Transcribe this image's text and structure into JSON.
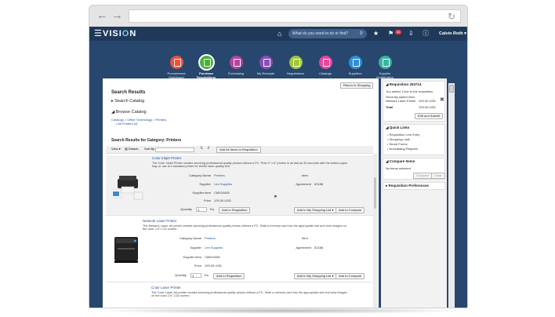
{
  "header": {
    "logo_prefix": "VISI",
    "logo_o": "O",
    "logo_suffix": "N",
    "search_placeholder": "What do you need to do or find?",
    "notifications_count": "11",
    "user_name": "Calvin Roth"
  },
  "nav": {
    "items": [
      {
        "label": "Procurement Dashboard",
        "color": "#e8533f"
      },
      {
        "label": "Purchase Requisitions",
        "color": "#4caf3d"
      },
      {
        "label": "Purchasing",
        "color": "#b4469e"
      },
      {
        "label": "My Receipts",
        "color": "#8b4fb5"
      },
      {
        "label": "Negotiations",
        "color": "#9fc73b"
      },
      {
        "label": "Catalogs",
        "color": "#e7469c"
      },
      {
        "label": "Suppliers",
        "color": "#2f8fd8"
      },
      {
        "label": "Supplier Qualification",
        "color": "#39b3a0"
      }
    ],
    "active_index": 1
  },
  "main": {
    "return_button": "Return to Shopping",
    "search_results_title": "Search Results",
    "search_catalog": "Search Catalog",
    "browse_catalog": "Browse Catalog",
    "breadcrumb": "Catalogs > Office Technology > Printers",
    "all_printers": "All Printers (4)",
    "results_heading": "Search Results for Category: Printers",
    "toolbar": {
      "view": "View",
      "detach": "Detach",
      "sort_by": "Sort By",
      "add_all": "Add All Items to Requisition"
    }
  },
  "products": [
    {
      "name": "Color Inkjet Printer",
      "description_1": "The Color Inkjet Printer creates stunning professional quality photos without a PC. Print 4\" x 6\" photos in as fast as 30 seconds with the button paper",
      "description_2": "tray, or use is a standard printer for terrific laser-quality text.",
      "category_label": "Category Name",
      "category_value": "Printers",
      "item_label": "Item",
      "supplier_label": "Supplier",
      "supplier_value": "Lee Supplies",
      "agreement_label": "Agreement",
      "agreement_value": "52188",
      "supplier_item_label": "Supplier Item",
      "supplier_item_value": "CM024405",
      "price_label": "Price",
      "price_value": "129.00 USD",
      "quantity_label": "Quantity",
      "quantity_value": "1",
      "uom": "Ea",
      "add_to_req": "Add to Requisition",
      "add_to_list": "Add to My Shopping List",
      "add_to_compare": "Add to Compare"
    },
    {
      "name": "Network Laser Printer",
      "description_1": "The Network Laser Jet printer creates stunning professional quality photos without a PC. Slide a memory card into the appropriate slot and view images on",
      "description_2": "the color 2.5\" LCD screen.",
      "category_label": "Category Name",
      "category_value": "Printers",
      "item_label": "Item",
      "supplier_label": "Supplier",
      "supplier_value": "Lee Supplies",
      "agreement_label": "Agreement",
      "agreement_value": "52188",
      "supplier_item_label": "Supplier Item",
      "supplier_item_value": "CM024405",
      "price_label": "Price",
      "price_value": "199.00 USD",
      "quantity_label": "Quantity",
      "quantity_value": "1",
      "uom": "Ea",
      "add_to_req": "Add to Requisition",
      "add_to_list": "Add to My Shopping List",
      "add_to_compare": "Add to Compare"
    },
    {
      "name": "Color Laser Printer",
      "description_1": "The Color Laser Jet printer creates stunning professional quality photos without a PC. Slide a memory card into the appropriate slot and view images",
      "description_2": "on the color 2.5\" LCD screen."
    }
  ],
  "requisition": {
    "title": "Requisition 263714",
    "added_msg": "You added 1 line to the requisition.",
    "recent_label": "Recently added lines",
    "line_item": "Network Laser Printer",
    "line_price": "199.00 USD",
    "total_label": "Total",
    "total_value": "199.00 USD",
    "edit_submit": "Edit and Submit"
  },
  "quick_links": {
    "title": "Quick Links",
    "items": [
      "Requisition Line Entry",
      "Shopping Lists",
      "Smart Forms",
      "Noncatalog Request"
    ]
  },
  "compare": {
    "title": "Compare Items",
    "empty_msg": "No items selected.",
    "compare_btn": "Compare",
    "clear_btn": "Clear"
  },
  "requisition_preferences": "Requisition Preferences"
}
